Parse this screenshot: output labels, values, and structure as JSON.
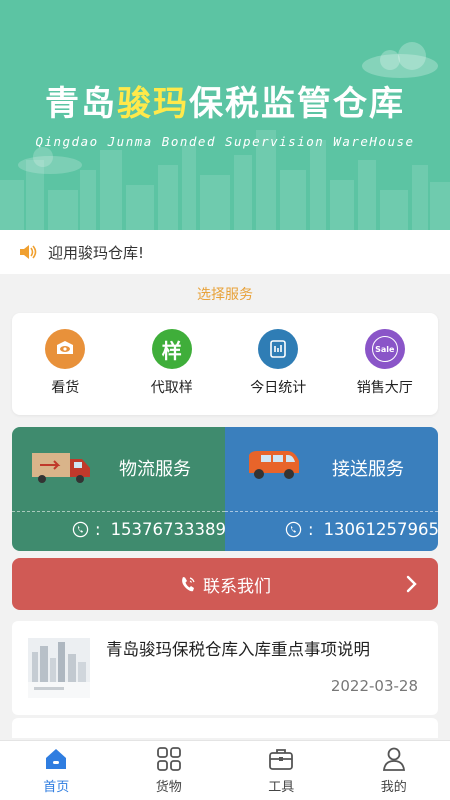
{
  "banner": {
    "title_part1": "青岛",
    "title_highlight": "骏玛",
    "title_part2": "保税监管仓库",
    "subtitle": "Qingdao Junma Bonded Supervision WareHouse"
  },
  "notice": {
    "icon": "speaker-icon",
    "text": "迎用骏玛仓库!"
  },
  "section_title": "选择服务",
  "services": [
    {
      "label": "看货",
      "icon": "eye-box-icon",
      "color": "#e8913a"
    },
    {
      "label": "代取样",
      "icon": "sample-icon",
      "glyph": "样",
      "color": "#3fae3a"
    },
    {
      "label": "今日统计",
      "icon": "stats-icon",
      "color": "#2f7db5"
    },
    {
      "label": "销售大厅",
      "icon": "sale-icon",
      "glyph": "Sale",
      "color": "#8a55c8"
    }
  ],
  "logistics": {
    "title": "物流服务",
    "phone": "15376733389",
    "icon": "truck-icon",
    "color": "#3f8b6e"
  },
  "shuttle": {
    "title": "接送服务",
    "phone": "13061257965",
    "icon": "van-icon",
    "color": "#3a7fbd"
  },
  "contact": {
    "label": "联系我们",
    "icon": "phone-icon",
    "color": "#d05a55"
  },
  "news": {
    "title": "青岛骏玛保税仓库入库重点事项说明",
    "date": "2022-03-28"
  },
  "tabs": [
    {
      "label": "首页",
      "icon": "home-icon",
      "active": true
    },
    {
      "label": "货物",
      "icon": "grid-icon",
      "active": false
    },
    {
      "label": "工具",
      "icon": "toolbox-icon",
      "active": false
    },
    {
      "label": "我的",
      "icon": "user-icon",
      "active": false
    }
  ],
  "colors": {
    "banner": "#5cc4a3",
    "accent": "#e8a23a",
    "tab_active": "#2f7de0"
  }
}
